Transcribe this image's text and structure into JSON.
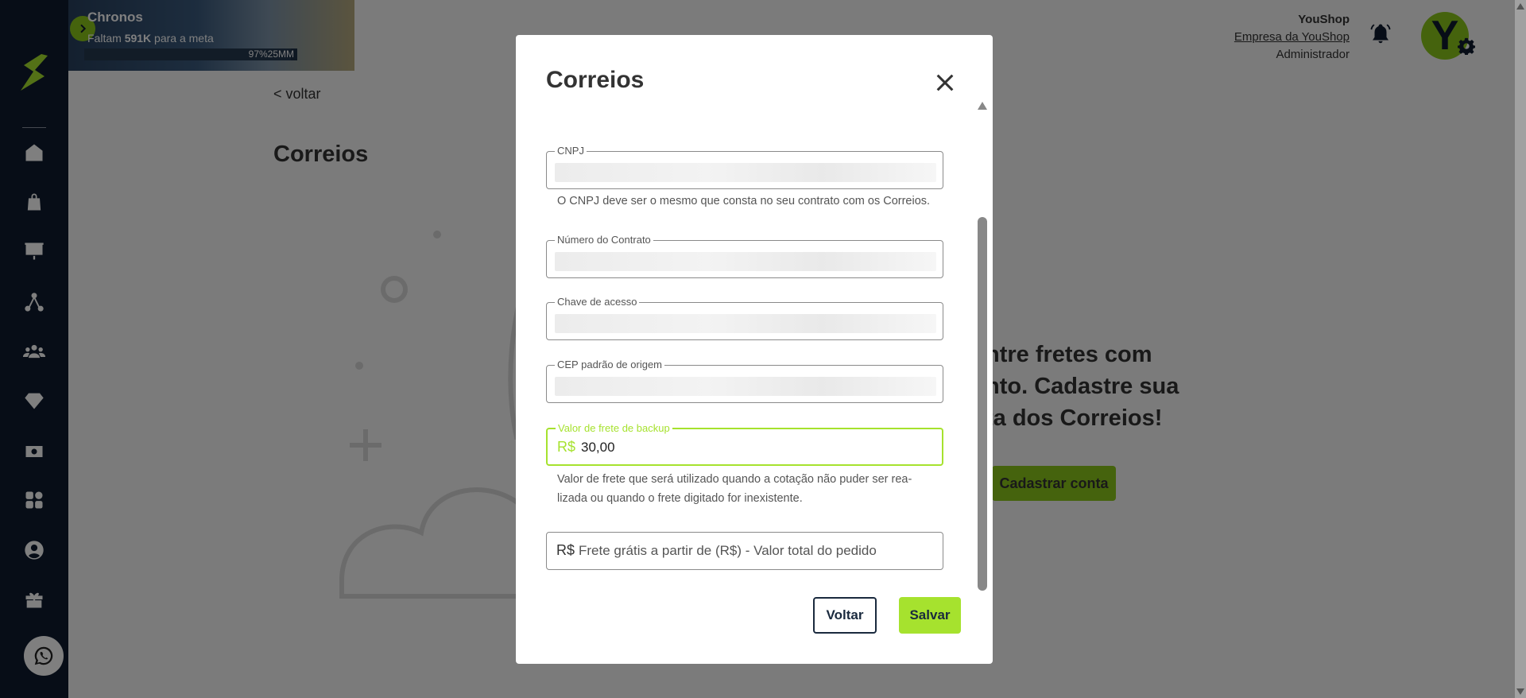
{
  "header": {
    "goal": {
      "title": "Chronos",
      "subtitle_prefix": "Faltam ",
      "subtitle_amount": "591K",
      "subtitle_suffix": " para a meta",
      "progress_label": "97%25MM",
      "progress_fraction": 0.97
    },
    "company": {
      "name": "YouShop",
      "link": "Empresa da YouShop",
      "role": "Administrador"
    },
    "avatar_letter": "Y"
  },
  "main": {
    "back_link": "< voltar",
    "title": "Correios",
    "empty_text_lines": [
      "ntre fretes com",
      "nto. Cadastre sua",
      "ta dos Correios!"
    ],
    "cadastrar_button": "Cadastrar conta"
  },
  "modal": {
    "title": "Correios",
    "fields": {
      "cnpj_label": "CNPJ",
      "cnpj_help": "O CNPJ deve ser o mesmo que consta no seu contrato com os Correios.",
      "contrato_label": "Número do Contrato",
      "chave_label": "Chave de acesso",
      "cep_label": "CEP padrão de origem",
      "backup_label": "Valor de frete de backup",
      "backup_prefix": "R$",
      "backup_value": "30,00",
      "backup_help": "Valor de frete que será utilizado quando a cotação não puder ser rea-lizada ou quando o frete digitado for inexistente.",
      "gratis_prefix": "R$",
      "gratis_placeholder": "Frete grátis a partir de (R$) - Valor total do pedido"
    },
    "buttons": {
      "voltar": "Voltar",
      "salvar": "Salvar"
    }
  },
  "colors": {
    "sidebar": "#0f1b2e",
    "accent": "#a6e22e",
    "accent_dark": "#8bc71b"
  },
  "icons": [
    "logo-icon",
    "home-icon",
    "bag-icon",
    "presentation-icon",
    "network-icon",
    "users-icon",
    "diamond-icon",
    "cash-icon",
    "apps-icon",
    "user-circle-icon",
    "gift-icon",
    "whatsapp-icon",
    "bell-icon",
    "gear-icon",
    "close-icon"
  ]
}
